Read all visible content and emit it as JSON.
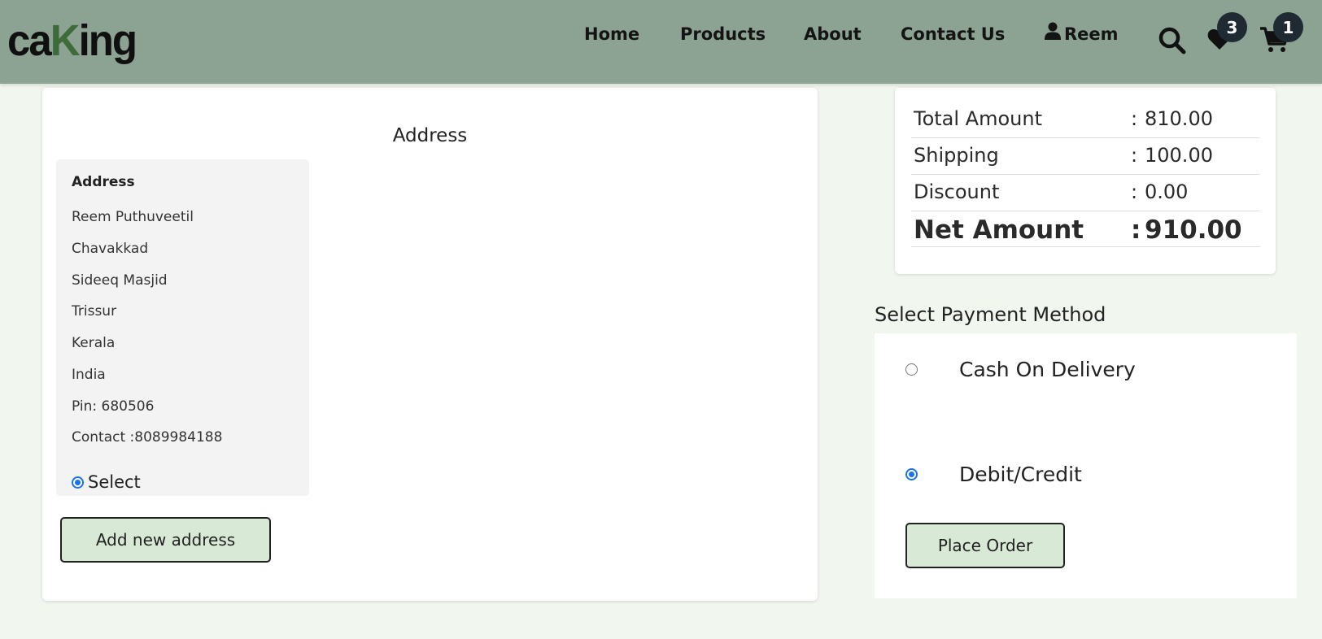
{
  "navbar": {
    "logo_part1": "ca",
    "logo_part2": "K",
    "logo_part3": "ing",
    "links": [
      "Home",
      "Products",
      "About",
      "Contact Us"
    ],
    "user_name": "Reem",
    "wishlist_count": "3",
    "cart_count": "1",
    "icons": [
      "user-icon",
      "search-icon",
      "heart-icon",
      "cart-icon"
    ]
  },
  "address": {
    "section_title": "Address",
    "card_heading": "Address",
    "lines": [
      "Reem Puthuveetil",
      "Chavakkad",
      "Sideeq Masjid",
      "Trissur",
      "Kerala",
      "India",
      "Pin: 680506",
      "Contact :8089984188"
    ],
    "select_label": "Select",
    "select_checked": true,
    "add_button": "Add new address"
  },
  "totals": {
    "rows": [
      {
        "label": "Total Amount",
        "colon": ":",
        "value": "810.00"
      },
      {
        "label": "Shipping",
        "colon": ":",
        "value": "100.00"
      },
      {
        "label": "Discount",
        "colon": ":",
        "value": "0.00"
      }
    ],
    "net": {
      "label": "Net Amount",
      "colon": ":",
      "value": "910.00"
    }
  },
  "payment": {
    "title": "Select Payment Method",
    "options": [
      {
        "label": "Cash On Delivery",
        "checked": false
      },
      {
        "label": "Debit/Credit",
        "checked": true
      }
    ],
    "place_order": "Place Order"
  },
  "colors": {
    "navbar": "#8ca394",
    "page_bg": "#f1f7ef",
    "button_bg": "#d8e9d5",
    "badge_bg": "#1f2a33",
    "radio_accent": "#1a73e8"
  }
}
